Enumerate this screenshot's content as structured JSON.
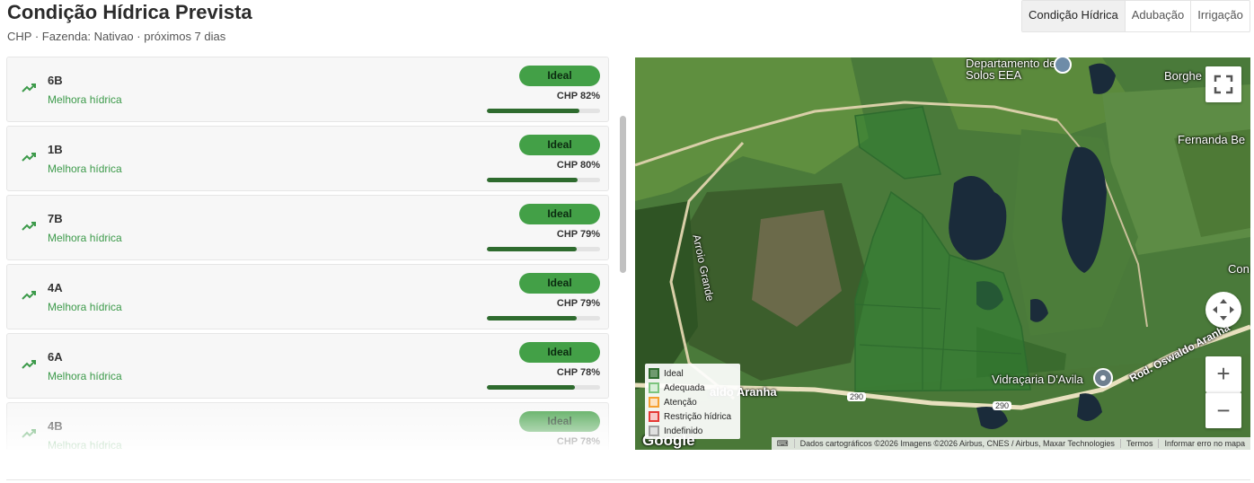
{
  "header": {
    "title": "Condição Hídrica Prevista",
    "subtitle": "CHP · Fazenda: Nativao · próximos 7 dias"
  },
  "tabs": [
    {
      "label": "Condição Hídrica",
      "active": true
    },
    {
      "label": "Adubação",
      "active": false
    },
    {
      "label": "Irrigação",
      "active": false
    }
  ],
  "plots": [
    {
      "name": "6B",
      "trend": "Melhora hídrica",
      "status": "Ideal",
      "chp_label": "CHP 82%",
      "chp": 82
    },
    {
      "name": "1B",
      "trend": "Melhora hídrica",
      "status": "Ideal",
      "chp_label": "CHP 80%",
      "chp": 80
    },
    {
      "name": "7B",
      "trend": "Melhora hídrica",
      "status": "Ideal",
      "chp_label": "CHP 79%",
      "chp": 79
    },
    {
      "name": "4A",
      "trend": "Melhora hídrica",
      "status": "Ideal",
      "chp_label": "CHP 79%",
      "chp": 79
    },
    {
      "name": "6A",
      "trend": "Melhora hídrica",
      "status": "Ideal",
      "chp_label": "CHP 78%",
      "chp": 78
    },
    {
      "name": "4B",
      "trend": "Melhora hídrica",
      "status": "Ideal",
      "chp_label": "CHP 78%",
      "chp": 78
    }
  ],
  "colors": {
    "badge_ideal": "#43a047",
    "trend_green": "#3c9a4a",
    "bar_fill": "#2e6b2e",
    "road": "#d9cfa8",
    "field_overlay": "#2e7d32"
  },
  "map": {
    "labels": {
      "departamento": "Departamento de Solos EEA",
      "borghe": "Borghe",
      "fernanda": "Fernanda Be",
      "arroio": "Arroio Grande",
      "con": "Con",
      "aranha_left": "aldo Aranha",
      "vidracaria": "Vidraçaria D'Avila",
      "rod": "Rod. Oswaldo Aranha",
      "road290a": "290",
      "road290b": "290",
      "google": "Google"
    },
    "legend": [
      {
        "label": "Ideal",
        "border": "#2e6b2e",
        "fill": "#6f9a6f"
      },
      {
        "label": "Adequada",
        "border": "#7cc47e",
        "fill": "#d7efd8"
      },
      {
        "label": "Atenção",
        "border": "#f5a030",
        "fill": "#fde3c2"
      },
      {
        "label": "Restrição hídrica",
        "border": "#e53935",
        "fill": "#f8c9c8"
      },
      {
        "label": "Indefinido",
        "border": "#9e9e9e",
        "fill": "#e0e0e0"
      }
    ],
    "attribution": {
      "keyboard": "⌨",
      "data": "Dados cartográficos ©2026 Imagens ©2026 Airbus, CNES / Airbus, Maxar Technologies",
      "terms": "Termos",
      "report": "Informar erro no mapa"
    },
    "controls": {
      "fullscreen": "fullscreen-icon",
      "camera": "camera-control-icon",
      "zoom_in": "+",
      "zoom_out": "−"
    }
  }
}
